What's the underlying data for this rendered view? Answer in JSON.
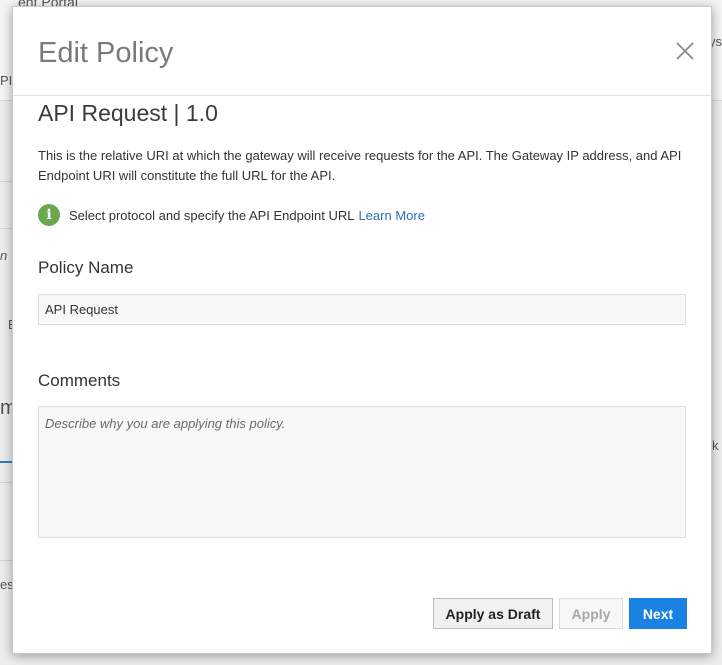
{
  "background": {
    "top_fragment": "ent Portal",
    "right_fragment": "ys",
    "left_fragment_1": "PI",
    "left_fragment_2": "n",
    "left_fragment_3": "E",
    "left_fragment_4": "m",
    "left_fragment_5": "es",
    "right_fragment_2": "k"
  },
  "modal": {
    "title": "Edit Policy",
    "close_icon": "close-icon",
    "policy_heading": "API Request | 1.0",
    "description": "This is the relative URI at which the gateway will receive requests for the API. The Gateway IP address, and API Endpoint URI will constitute the full URL for the API.",
    "info": {
      "icon": "info-icon",
      "icon_color": "#6aa84f",
      "text": "Select protocol and specify the API Endpoint URL",
      "link": "Learn More"
    },
    "policy_name": {
      "label": "Policy Name",
      "value": "API Request"
    },
    "comments": {
      "label": "Comments",
      "placeholder": "Describe why you are applying this policy."
    },
    "buttons": {
      "apply_draft": "Apply as Draft",
      "apply": "Apply",
      "next": "Next"
    },
    "colors": {
      "primary": "#1a82e2",
      "link": "#2a6fb5"
    }
  }
}
